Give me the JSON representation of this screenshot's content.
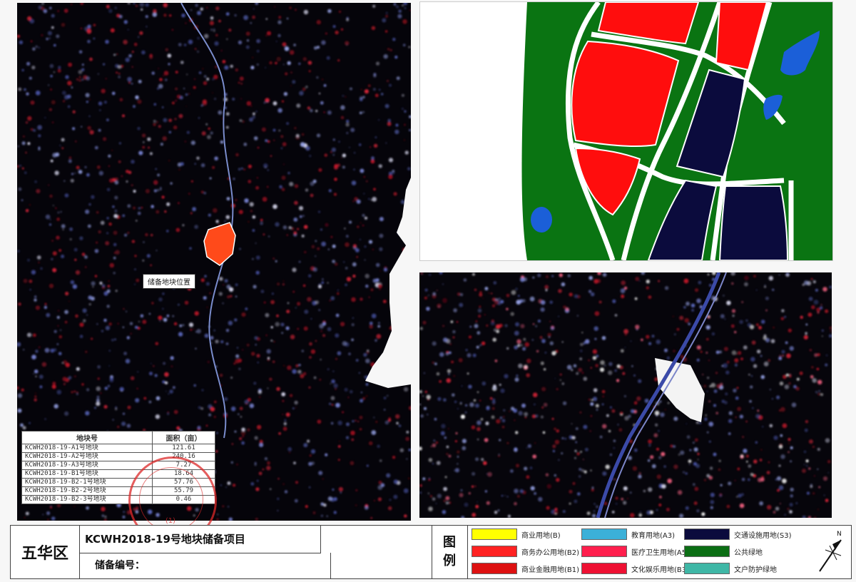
{
  "overview_map": {
    "location_label": "储备地块位置"
  },
  "parcel_table": {
    "headers": [
      "地块号",
      "面积（亩）"
    ],
    "rows": [
      {
        "id": "KCWH2018-19-A1号地块",
        "area": "121.61"
      },
      {
        "id": "KCWH2018-19-A2号地块",
        "area": "240.16"
      },
      {
        "id": "KCWH2018-19-A3号地块",
        "area": "7.27"
      },
      {
        "id": "KCWH2018-19-B1号地块",
        "area": "18.64"
      },
      {
        "id": "KCWH2018-19-B2-1号地块",
        "area": "57.76"
      },
      {
        "id": "KCWH2018-19-B2-2号地块",
        "area": "55.79"
      },
      {
        "id": "KCWH2018-19-B2-3号地块",
        "area": "0.46"
      }
    ]
  },
  "stamp": {
    "text": "(1)"
  },
  "footer": {
    "district": "五华区",
    "project_title": "KCWH2018-19号地块储备项目",
    "reserve_no_label": "储备编号："
  },
  "legend": {
    "title_chars": [
      "图",
      "例"
    ],
    "items": [
      {
        "label": "商业用地(B)",
        "color": "#ffff00"
      },
      {
        "label": "商务办公用地(B2)",
        "color": "#ff2222"
      },
      {
        "label": "商业金融用地(B1)",
        "color": "#dd1111"
      },
      {
        "label": "教育用地(A3)",
        "color": "#3bb0d8"
      },
      {
        "label": "医疗卫生用地(A5)",
        "color": "#ff1f4d"
      },
      {
        "label": "文化娱乐用地(B3)",
        "color": "#ee1133"
      },
      {
        "label": "交通设施用地(S3)",
        "color": "#0b0b3d"
      },
      {
        "label": "公共绿地",
        "color": "#0b6e14"
      },
      {
        "label": "文户防护绿地",
        "color": "#3fb7a6"
      }
    ]
  },
  "north_arrow": {
    "label": "N"
  }
}
